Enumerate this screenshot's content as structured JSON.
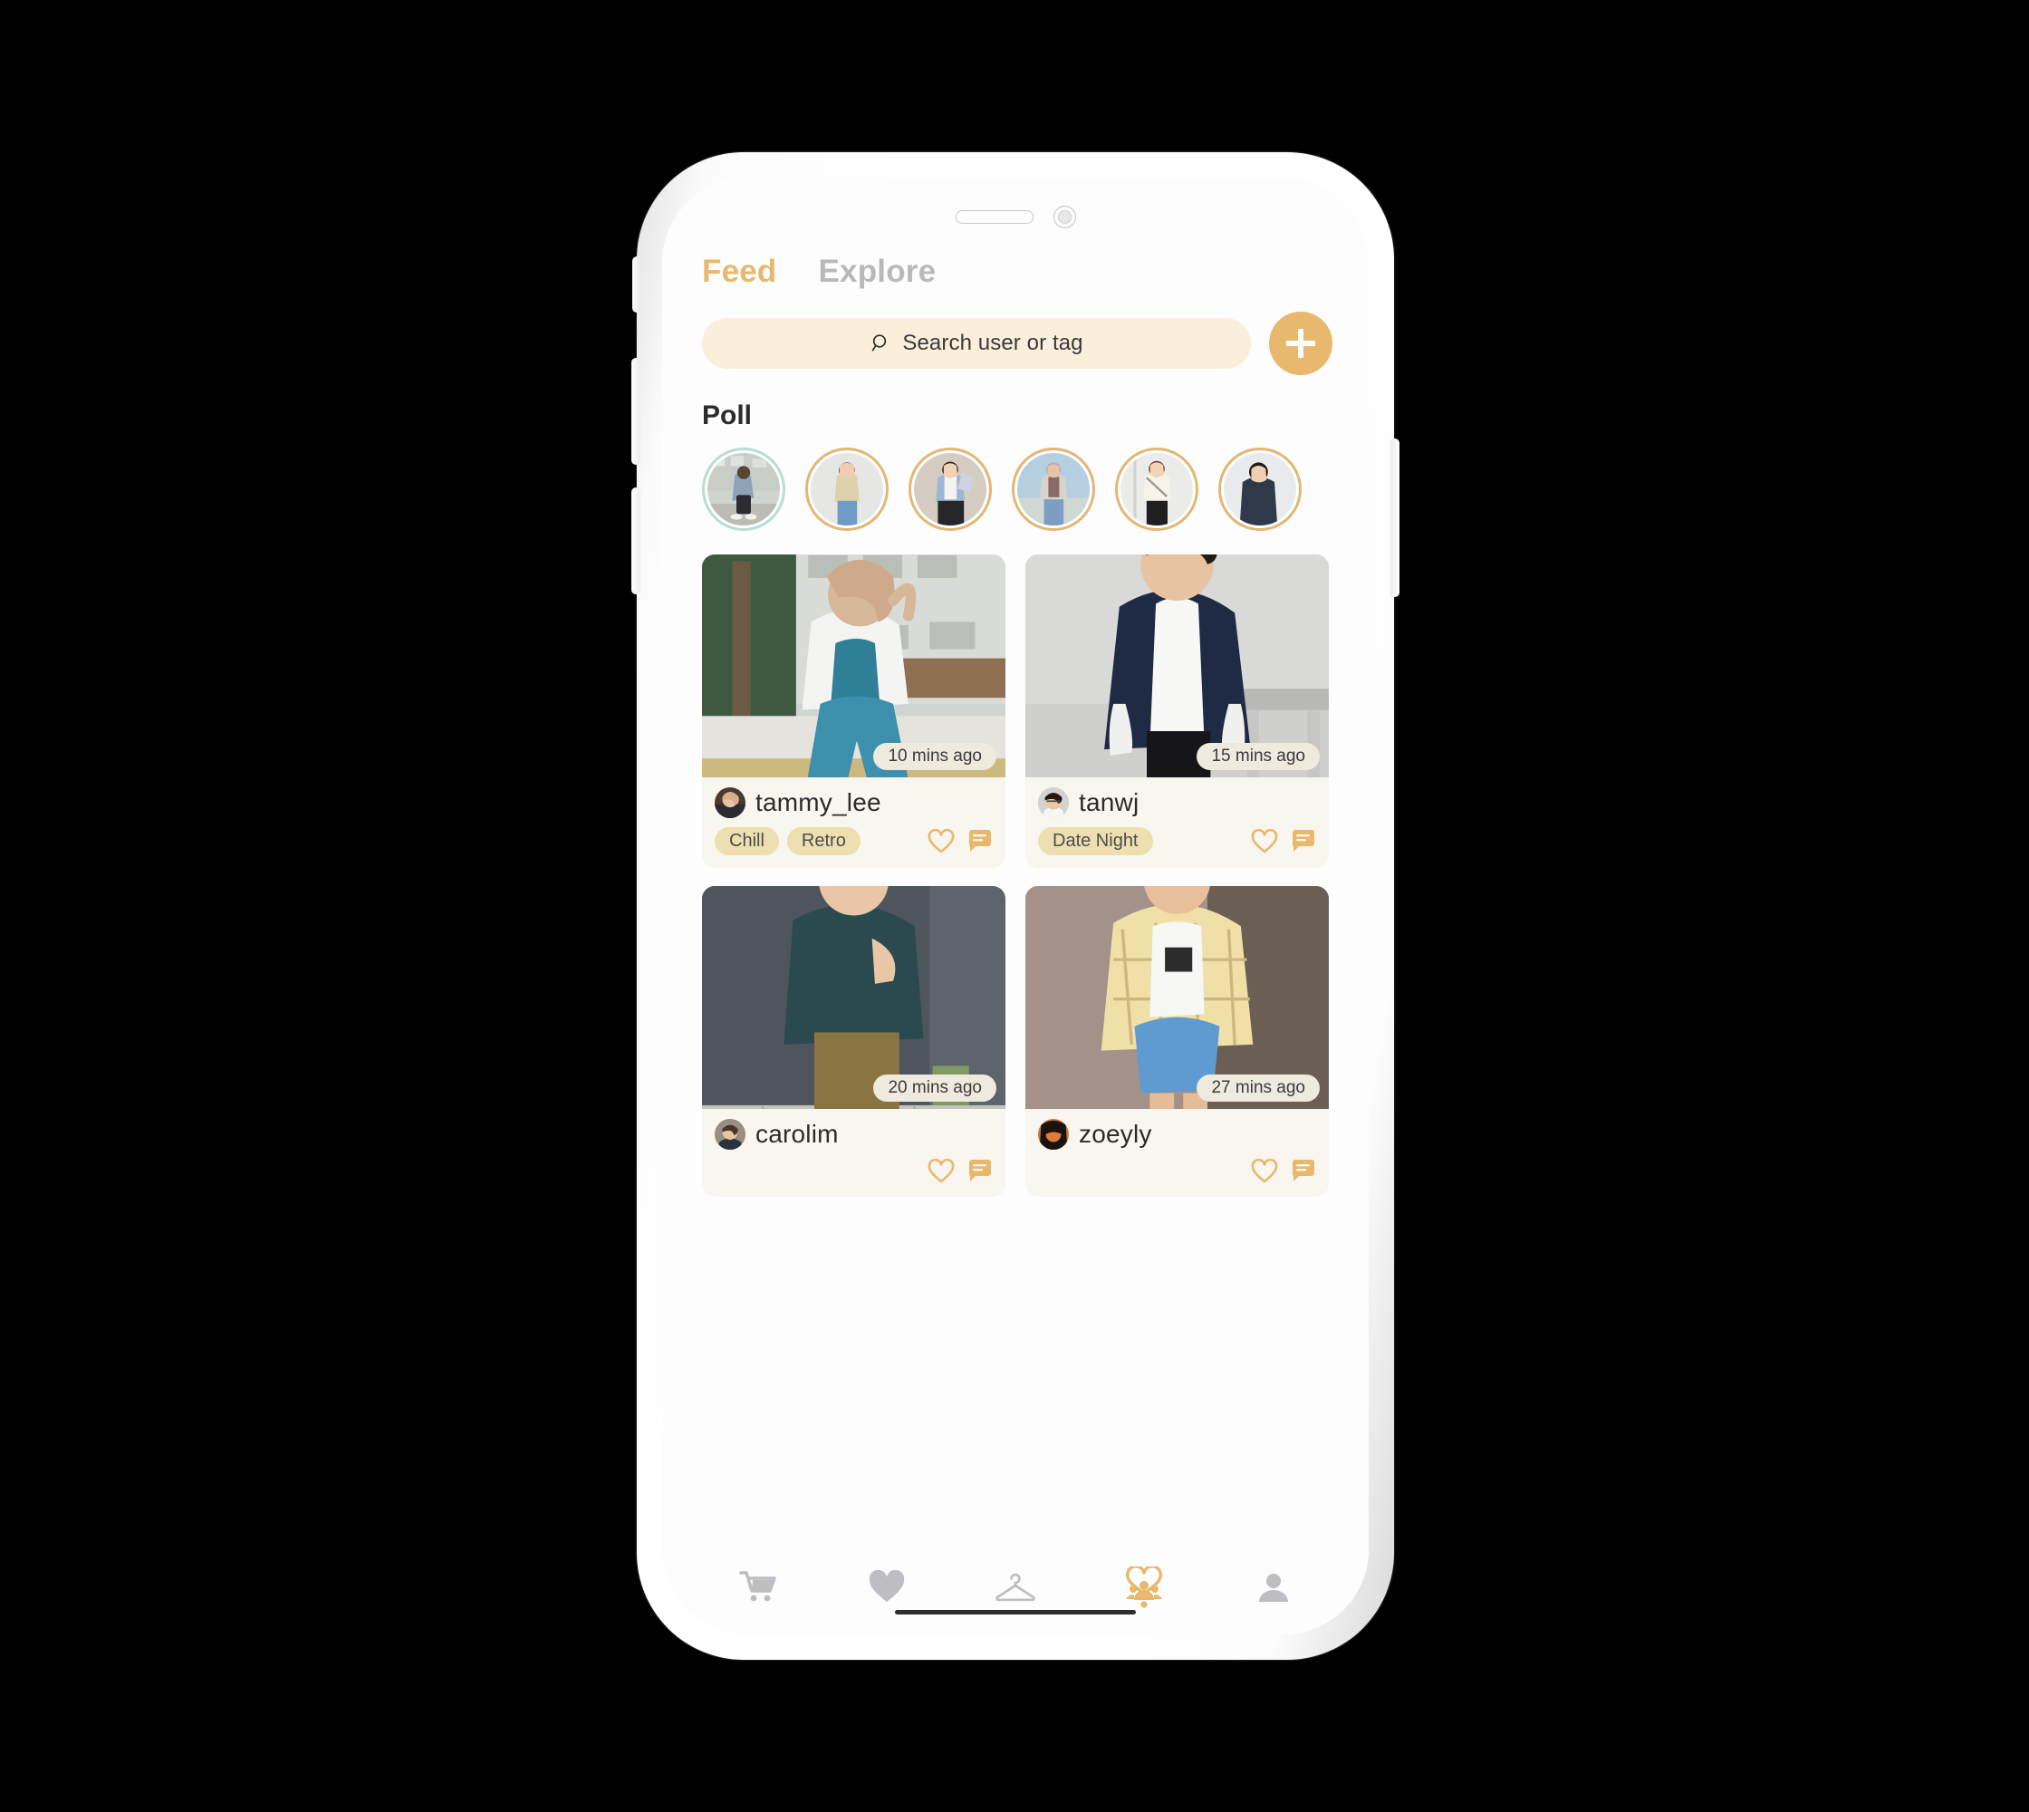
{
  "app": {
    "accent_gold": "#E8B86D",
    "accent_mint": "#B6DED2",
    "card_bg": "#F8F6EE",
    "pill_bg": "#EDDFB0",
    "search_bg": "#FBEEDA",
    "inactive_gray": "#B9B9B9"
  },
  "tabs": [
    {
      "label": "Feed",
      "active": true
    },
    {
      "label": "Explore",
      "active": false
    }
  ],
  "search": {
    "placeholder": "Search user or tag",
    "icon": "search-icon"
  },
  "add_button": {
    "icon": "plus-icon",
    "label": "+"
  },
  "poll": {
    "title": "Poll",
    "stories": [
      {
        "name": "own-story",
        "own": true,
        "border": "#B6DED2"
      },
      {
        "name": "story-2",
        "own": false,
        "border": "#E3B673"
      },
      {
        "name": "story-3",
        "own": false,
        "border": "#E3B673"
      },
      {
        "name": "story-4",
        "own": false,
        "border": "#E3B673"
      },
      {
        "name": "story-5",
        "own": false,
        "border": "#E3B673"
      },
      {
        "name": "story-6",
        "own": false,
        "border": "#E3B673"
      }
    ]
  },
  "feed": {
    "posts": [
      {
        "username": "tammy_lee",
        "timestamp": "10 mins ago",
        "tags": [
          "Chill",
          "Retro"
        ],
        "like_icon": "heart-outline-icon",
        "comment_icon": "comment-icon"
      },
      {
        "username": "tanwj",
        "timestamp": "15 mins ago",
        "tags": [
          "Date Night"
        ],
        "like_icon": "heart-outline-icon",
        "comment_icon": "comment-icon"
      },
      {
        "username": "carolim",
        "timestamp": "20 mins ago",
        "tags": [],
        "like_icon": "heart-outline-icon",
        "comment_icon": "comment-icon"
      },
      {
        "username": "zoeyly",
        "timestamp": "27 mins ago",
        "tags": [],
        "like_icon": "heart-outline-icon",
        "comment_icon": "comment-icon"
      }
    ]
  },
  "navbar": {
    "items": [
      {
        "icon": "cart-icon",
        "active": false
      },
      {
        "icon": "heart-icon",
        "active": false
      },
      {
        "icon": "hanger-icon",
        "active": false
      },
      {
        "icon": "community-icon",
        "active": true
      },
      {
        "icon": "profile-icon",
        "active": false
      }
    ]
  }
}
